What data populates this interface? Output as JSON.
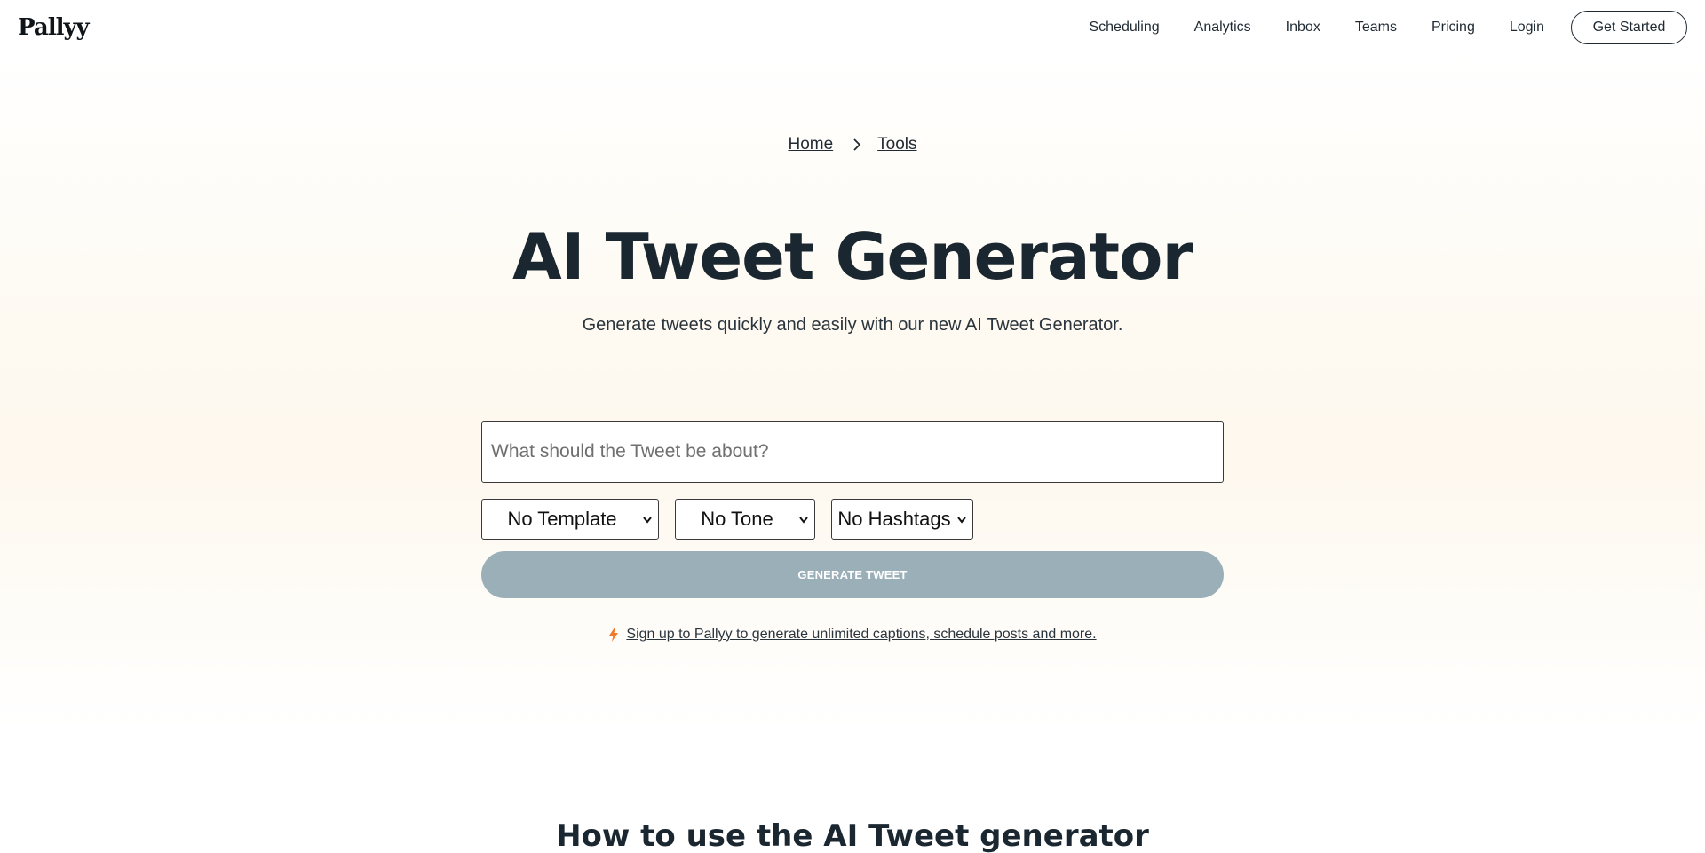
{
  "header": {
    "logo": "Pallyy",
    "nav": [
      "Scheduling",
      "Analytics",
      "Inbox",
      "Teams",
      "Pricing",
      "Login"
    ],
    "cta": "Get Started"
  },
  "breadcrumb": {
    "home": "Home",
    "tools": "Tools",
    "separator_icon": "chevron-right-icon"
  },
  "hero": {
    "title": "AI Tweet Generator",
    "subtitle": "Generate tweets quickly and easily with our new AI Tweet Generator."
  },
  "form": {
    "topic_placeholder": "What should the Tweet be about?",
    "template_selected": "No Template",
    "tone_selected": "No Tone",
    "hashtags_selected": "No Hashtags",
    "generate_label": "GENERATE TWEET",
    "generate_color": "#9aafb7"
  },
  "signup": {
    "icon": "lightning-bolt-icon",
    "text": "Sign up to Pallyy to generate unlimited captions, schedule posts and more."
  },
  "section": {
    "how_to_title": "How to use the AI Tweet generator"
  }
}
